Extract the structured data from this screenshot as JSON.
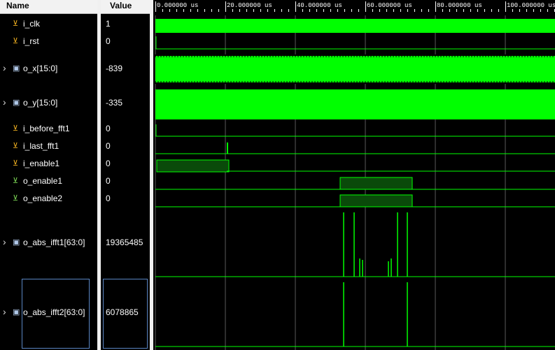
{
  "header": {
    "name_label": "Name",
    "value_label": "Value"
  },
  "ruler": {
    "labels": [
      "0.000000 us",
      "20.000000 us",
      "40.000000 us",
      "60.000000 us",
      "80.000000 us",
      "100.000000 us"
    ]
  },
  "signals": [
    {
      "name": "i_clk",
      "value": "1",
      "icon": "bit-input-icon",
      "expandable": false
    },
    {
      "name": "i_rst",
      "value": "0",
      "icon": "bit-input-icon",
      "expandable": false
    },
    {
      "name": "o_x[15:0]",
      "value": "-839",
      "icon": "bus-icon",
      "expandable": true
    },
    {
      "name": "o_y[15:0]",
      "value": "-335",
      "icon": "bus-icon",
      "expandable": true
    },
    {
      "name": "i_before_fft1",
      "value": "0",
      "icon": "bit-input-icon",
      "expandable": false
    },
    {
      "name": "i_last_fft1",
      "value": "0",
      "icon": "bit-input-icon",
      "expandable": false
    },
    {
      "name": "i_enable1",
      "value": "0",
      "icon": "bit-input-icon",
      "expandable": false
    },
    {
      "name": "o_enable1",
      "value": "0",
      "icon": "bit-output-icon",
      "expandable": false
    },
    {
      "name": "o_enable2",
      "value": "0",
      "icon": "bit-output-icon",
      "expandable": false
    },
    {
      "name": "o_abs_ifft1[63:0]",
      "value": "19365485",
      "icon": "bus-icon",
      "expandable": true
    },
    {
      "name": "o_abs_ifft2[63:0]",
      "value": "6078865",
      "icon": "bus-icon",
      "expandable": true
    }
  ],
  "colors": {
    "wave": "#00ff00",
    "wave_fill": "#0a4a0a",
    "grid": "#5a5a5a",
    "background": "#000000"
  }
}
